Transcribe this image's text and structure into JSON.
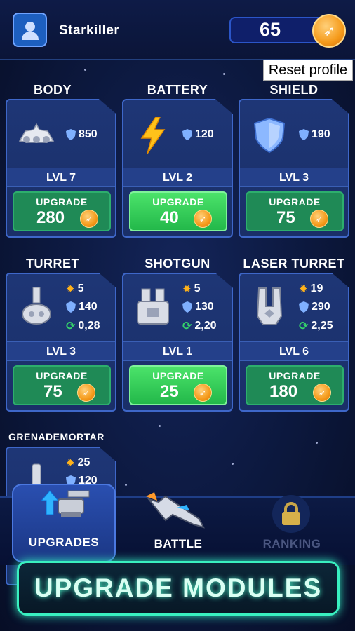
{
  "player": {
    "name": "Starkiller",
    "coins": "65"
  },
  "reset_button": "Reset profile",
  "modules": [
    {
      "title": "BODY",
      "icon": "ship-body-icon",
      "stats": [
        {
          "type": "shield",
          "value": "850"
        }
      ],
      "level": "LVL 7",
      "upgrade_label": "UPGRADE",
      "cost": "280",
      "affordable": false
    },
    {
      "title": "BATTERY",
      "icon": "lightning-bolt-icon",
      "stats": [
        {
          "type": "shield",
          "value": "120"
        }
      ],
      "level": "LVL 2",
      "upgrade_label": "UPGRADE",
      "cost": "40",
      "affordable": true
    },
    {
      "title": "SHIELD",
      "icon": "shield-icon",
      "stats": [
        {
          "type": "shield",
          "value": "190"
        }
      ],
      "level": "LVL 3",
      "upgrade_label": "UPGRADE",
      "cost": "75",
      "affordable": false
    },
    {
      "title": "TURRET",
      "icon": "turret-icon",
      "stats": [
        {
          "type": "damage",
          "value": "5"
        },
        {
          "type": "shield",
          "value": "140"
        },
        {
          "type": "reload",
          "value": "0,28"
        }
      ],
      "level": "LVL 3",
      "upgrade_label": "UPGRADE",
      "cost": "75",
      "affordable": false
    },
    {
      "title": "SHOTGUN",
      "icon": "shotgun-turret-icon",
      "stats": [
        {
          "type": "damage",
          "value": "5"
        },
        {
          "type": "shield",
          "value": "130"
        },
        {
          "type": "reload",
          "value": "2,20"
        }
      ],
      "level": "LVL 1",
      "upgrade_label": "UPGRADE",
      "cost": "25",
      "affordable": true
    },
    {
      "title": "LASER TURRET",
      "icon": "laser-turret-icon",
      "stats": [
        {
          "type": "damage",
          "value": "19"
        },
        {
          "type": "shield",
          "value": "290"
        },
        {
          "type": "reload",
          "value": "2,25"
        }
      ],
      "level": "LVL 6",
      "upgrade_label": "UPGRADE",
      "cost": "180",
      "affordable": false
    },
    {
      "title": "GRENADEMORTAR",
      "icon": "mortar-icon",
      "stats": [
        {
          "type": "damage",
          "value": "25"
        },
        {
          "type": "shield",
          "value": "120"
        }
      ]
    }
  ],
  "nav": {
    "tabs": [
      {
        "label": "UPGRADES",
        "icon": "upgrade-turret-icon",
        "active": true
      },
      {
        "label": "BATTLE",
        "icon": "spaceship-icon",
        "active": false
      },
      {
        "label": "RANKING",
        "icon": "lock-icon",
        "active": false,
        "locked": true
      }
    ]
  },
  "banner": "UPGRADE MODULES",
  "colors": {
    "accent_green": "#23b84a",
    "neon_teal": "#39f0c0",
    "coin_orange": "#f59a1a",
    "card_blue": "#1e3676"
  }
}
